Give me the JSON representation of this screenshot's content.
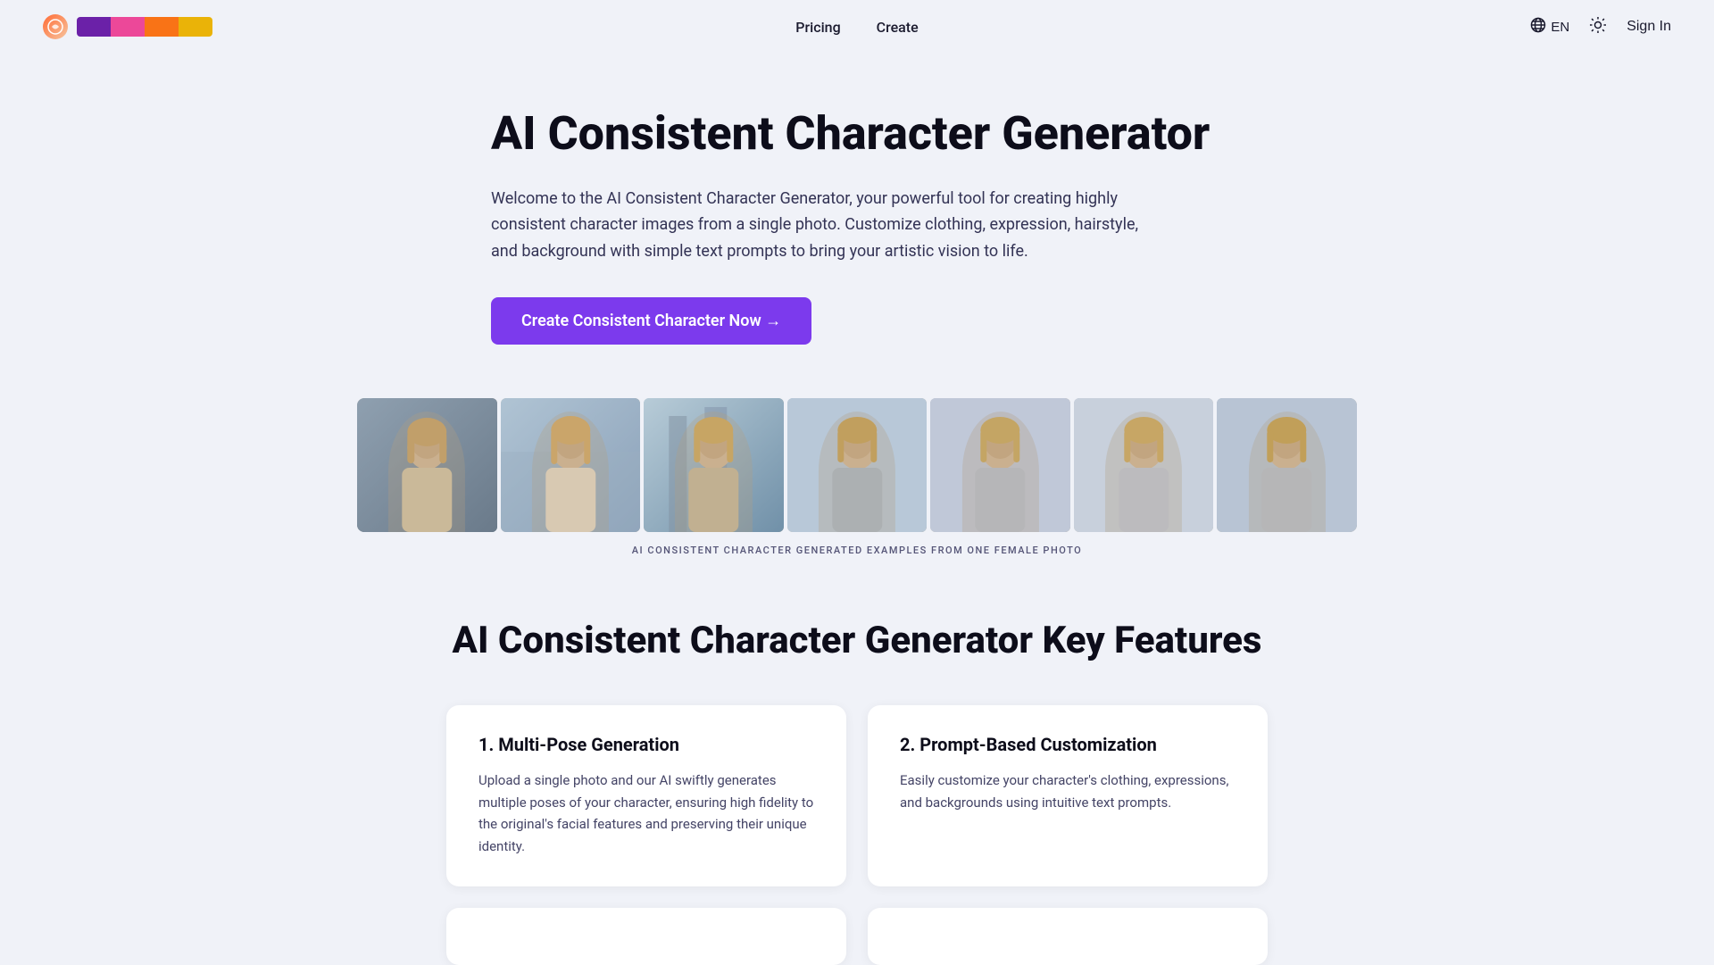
{
  "header": {
    "nav": {
      "pricing_label": "Pricing",
      "create_label": "Create"
    },
    "lang_label": "EN",
    "sign_in_label": "Sign In"
  },
  "hero": {
    "title": "AI Consistent Character Generator",
    "description": "Welcome to the AI Consistent Character Generator, your powerful tool for creating highly consistent character images from a single photo. Customize clothing, expression, hairstyle, and background with simple text prompts to bring your artistic vision to life.",
    "cta_label": "Create Consistent Character Now →"
  },
  "gallery": {
    "caption": "AI CONSISTENT CHARACTER GENERATED EXAMPLES FROM ONE FEMALE PHOTO"
  },
  "features": {
    "section_title": "AI Consistent Character Generator Key Features",
    "cards": [
      {
        "title": "1. Multi-Pose Generation",
        "description": "Upload a single photo and our AI swiftly generates multiple poses of your character, ensuring high fidelity to the original's facial features and preserving their unique identity."
      },
      {
        "title": "2. Prompt-Based Customization",
        "description": "Easily customize your character's clothing, expressions, and backgrounds using intuitive text prompts."
      }
    ]
  }
}
